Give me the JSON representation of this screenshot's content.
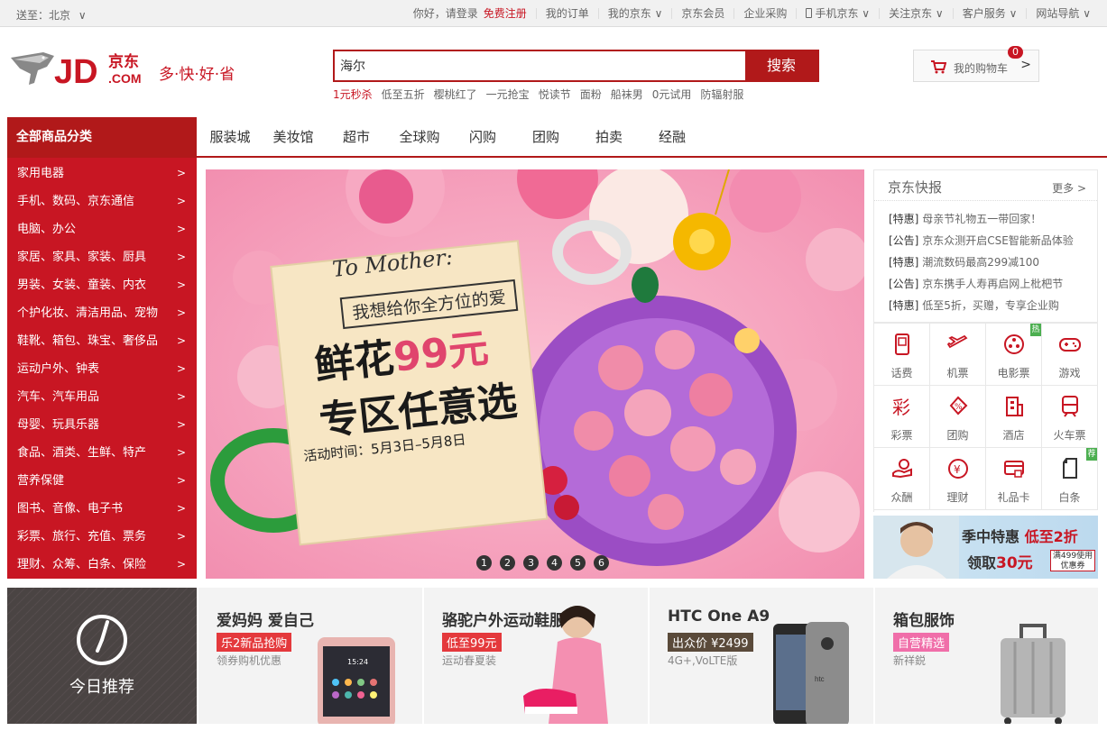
{
  "topbar": {
    "location": "送至：北京",
    "greeting": "你好，请登录",
    "register": "免费注册",
    "links": [
      "我的订单",
      "我的京东",
      "京东会员",
      "企业采购",
      "手机京东",
      "关注京东",
      "客户服务",
      "网站导航"
    ]
  },
  "logo": {
    "jd": "JD",
    "cn": "京东",
    "com": ".COM",
    "slogan": "多·快·好·省"
  },
  "search": {
    "value": "海尔",
    "button": "搜索",
    "hot": [
      "1元秒杀",
      "低至五折",
      "樱桃红了",
      "一元抢宝",
      "悦读节",
      "面粉",
      "船袜男",
      "0元试用",
      "防辐射服"
    ]
  },
  "cart": {
    "label": "我的购物车",
    "count": "0",
    "arrow": ">"
  },
  "nav": {
    "all": "全部商品分类",
    "items": [
      "服装城",
      "美妆馆",
      "超市",
      "全球购",
      "闪购",
      "团购",
      "拍卖",
      "经融"
    ]
  },
  "categories": [
    "家用电器",
    "手机、数码、京东通信",
    "电脑、办公",
    "家居、家具、家装、厨具",
    "男装、女装、童装、内衣",
    "个护化妆、清洁用品、宠物",
    "鞋靴、箱包、珠宝、奢侈品",
    "运动户外、钟表",
    "汽车、汽车用品",
    "母婴、玩具乐器",
    "食品、酒类、生鲜、特产",
    "营养保健",
    "图书、音像、电子书",
    "彩票、旅行、充值、票务",
    "理财、众筹、白条、保险"
  ],
  "banner": {
    "to": "To Mother:",
    "line1": "我想给你全方位的爱",
    "line2a": "鲜花",
    "line2b": "99元",
    "line3": "专区任意选",
    "time": "活动时间：5月3日–5月8日",
    "dots": [
      "1",
      "2",
      "3",
      "4",
      "5",
      "6"
    ]
  },
  "news": {
    "title": "京东快报",
    "more": "更多 >",
    "items": [
      {
        "tag": "[特惠]",
        "text": "母亲节礼物五一带回家！"
      },
      {
        "tag": "[公告]",
        "text": "京东众测开启CSE智能新品体验"
      },
      {
        "tag": "[特惠]",
        "text": "潮流数码最高299减100"
      },
      {
        "tag": "[公告]",
        "text": "京东携手人寿再启网上枇杷节"
      },
      {
        "tag": "[特惠]",
        "text": "低至5折，买赠，专享企业购"
      }
    ]
  },
  "services": [
    {
      "label": "话费",
      "icon": "phone-icon",
      "tag": ""
    },
    {
      "label": "机票",
      "icon": "plane-icon",
      "tag": ""
    },
    {
      "label": "电影票",
      "icon": "film-icon",
      "tag": "热"
    },
    {
      "label": "游戏",
      "icon": "gamepad-icon",
      "tag": ""
    },
    {
      "label": "彩票",
      "icon": "lottery-icon",
      "tag": ""
    },
    {
      "label": "团购",
      "icon": "groupbuy-icon",
      "tag": ""
    },
    {
      "label": "酒店",
      "icon": "hotel-icon",
      "tag": ""
    },
    {
      "label": "火车票",
      "icon": "train-icon",
      "tag": ""
    },
    {
      "label": "众酬",
      "icon": "crowdfund-icon",
      "tag": ""
    },
    {
      "label": "理财",
      "icon": "finance-icon",
      "tag": ""
    },
    {
      "label": "礼品卡",
      "icon": "giftcard-icon",
      "tag": ""
    },
    {
      "label": "白条",
      "icon": "iou-icon",
      "tag": "荐"
    }
  ],
  "promo": {
    "a": "季中特惠",
    "b": "低至2折",
    "c": "领取",
    "d": "30元",
    "coupon1": "满499使用",
    "coupon2": "优惠券"
  },
  "today": {
    "label": "今日推荐"
  },
  "cards": [
    {
      "title": "爱妈妈 爱自己",
      "badge": "乐2新品抢购",
      "sub": "领券购机优惠",
      "color": "#e4393c"
    },
    {
      "title": "骆驼户外运动鞋服",
      "badge": "低至99元",
      "sub": "运动春夏装",
      "color": "#e4393c"
    },
    {
      "title": "HTC One A9",
      "badge": "出众价 ¥2499",
      "sub": "4G+,VoLTE版",
      "color": "#5a4a3a"
    },
    {
      "title": "箱包服饰",
      "badge": "自营精选",
      "sub": "新祥鋭",
      "color": "#f06ea9"
    }
  ],
  "phone_screen": {
    "time": "15:24"
  }
}
